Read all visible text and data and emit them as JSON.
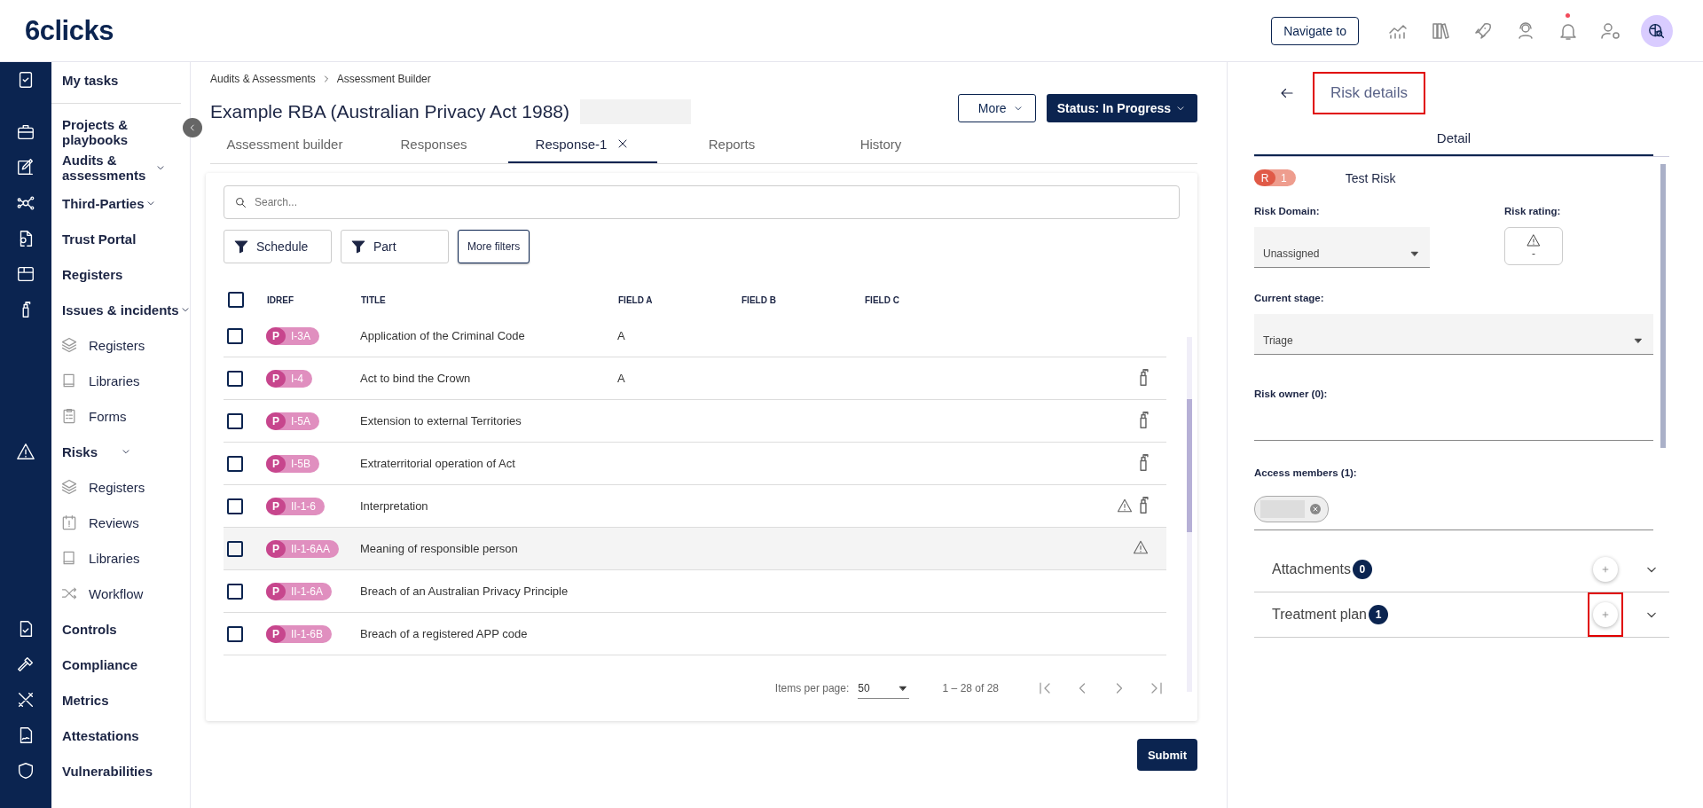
{
  "header": {
    "logo": "6clicks",
    "navigate_button": "Navigate to",
    "notification_unread": true
  },
  "sidebar": {
    "items": [
      {
        "label": "My tasks",
        "expandable": false
      },
      {
        "label": "Projects & playbooks",
        "expandable": false
      },
      {
        "label": "Audits & assessments",
        "expandable": true
      },
      {
        "label": "Third-Parties",
        "expandable": true
      },
      {
        "label": "Trust Portal",
        "expandable": false
      },
      {
        "label": "Registers",
        "expandable": false
      },
      {
        "label": "Issues & incidents",
        "expandable": true,
        "children": [
          {
            "label": "Registers"
          },
          {
            "label": "Libraries"
          },
          {
            "label": "Forms"
          }
        ]
      },
      {
        "label": "Risks",
        "expandable": true,
        "children": [
          {
            "label": "Registers"
          },
          {
            "label": "Reviews"
          },
          {
            "label": "Libraries"
          },
          {
            "label": "Workflow"
          }
        ]
      },
      {
        "label": "Controls",
        "expandable": false
      },
      {
        "label": "Compliance",
        "expandable": false
      },
      {
        "label": "Metrics",
        "expandable": false
      },
      {
        "label": "Attestations",
        "expandable": false
      },
      {
        "label": "Vulnerabilities",
        "expandable": false
      }
    ]
  },
  "main": {
    "breadcrumb": [
      "Audits & Assessments",
      "Assessment Builder"
    ],
    "title": "Example RBA (Australian Privacy Act 1988)",
    "more_button": "More",
    "status_button": "Status: In Progress",
    "tabs": [
      {
        "label": "Assessment builder",
        "selected": false,
        "closable": false
      },
      {
        "label": "Responses",
        "selected": false,
        "closable": false
      },
      {
        "label": "Response-1",
        "selected": true,
        "closable": true
      },
      {
        "label": "Reports",
        "selected": false,
        "closable": false
      },
      {
        "label": "History",
        "selected": false,
        "closable": false
      }
    ],
    "search": {
      "placeholder": "Search..."
    },
    "filters": [
      {
        "label": "Schedule",
        "kind": "filter"
      },
      {
        "label": "Part",
        "kind": "filter"
      },
      {
        "label": "More filters",
        "kind": "button"
      }
    ],
    "table": {
      "header_checked": false,
      "columns": [
        "IDREF",
        "TITLE",
        "FIELD A",
        "FIELD B",
        "FIELD C"
      ],
      "rows": [
        {
          "checked": false,
          "hovered": false,
          "prefix": "P",
          "idref": "I-3A",
          "title": "Application of the Criminal Code",
          "field_a": "A",
          "has_risk": false,
          "has_issue": false
        },
        {
          "checked": false,
          "hovered": false,
          "prefix": "P",
          "idref": "I-4",
          "title": "Act to bind the Crown",
          "field_a": "A",
          "has_risk": false,
          "has_issue": true
        },
        {
          "checked": false,
          "hovered": false,
          "prefix": "P",
          "idref": "I-5A",
          "title": "Extension to external Territories",
          "has_risk": false,
          "has_issue": true
        },
        {
          "checked": false,
          "hovered": false,
          "prefix": "P",
          "idref": "I-5B",
          "title": "Extraterritorial operation of Act",
          "has_risk": false,
          "has_issue": true
        },
        {
          "checked": false,
          "hovered": false,
          "prefix": "P",
          "idref": "II-1-6",
          "title": "Interpretation",
          "has_risk": true,
          "has_issue": true
        },
        {
          "checked": false,
          "hovered": true,
          "prefix": "P",
          "idref": "II-1-6AA",
          "title": "Meaning of responsible person",
          "has_risk": true,
          "has_issue": false
        },
        {
          "checked": false,
          "hovered": false,
          "prefix": "P",
          "idref": "II-1-6A",
          "title": "Breach of an Australian Privacy Principle",
          "has_risk": false,
          "has_issue": false
        },
        {
          "checked": false,
          "hovered": false,
          "prefix": "P",
          "idref": "II-1-6B",
          "title": "Breach of a registered APP code",
          "has_risk": false,
          "has_issue": false
        }
      ]
    },
    "pagination": {
      "label": "Items per page:",
      "page_size": "50",
      "range": "1 – 28 of 28"
    },
    "submit_button": "Submit"
  },
  "risk_panel": {
    "title": "Risk details",
    "title_highlighted": true,
    "tabs": [
      {
        "label": "Detail",
        "selected": true
      }
    ],
    "badge_prefix": "R",
    "badge_number": "1",
    "name": "Test Risk",
    "risk_domain": {
      "label": "Risk Domain:",
      "value": "Unassigned"
    },
    "risk_rating": {
      "label": "Risk rating:",
      "value": "-"
    },
    "current_stage": {
      "label": "Current stage:",
      "value": "Triage"
    },
    "risk_owner": {
      "label": "Risk owner (0):"
    },
    "access_members": {
      "label": "Access members (1):"
    },
    "sections": [
      {
        "label": "Attachments",
        "count": "0",
        "add_highlighted": false
      },
      {
        "label": "Treatment plan",
        "count": "1",
        "add_highlighted": true
      }
    ]
  }
}
